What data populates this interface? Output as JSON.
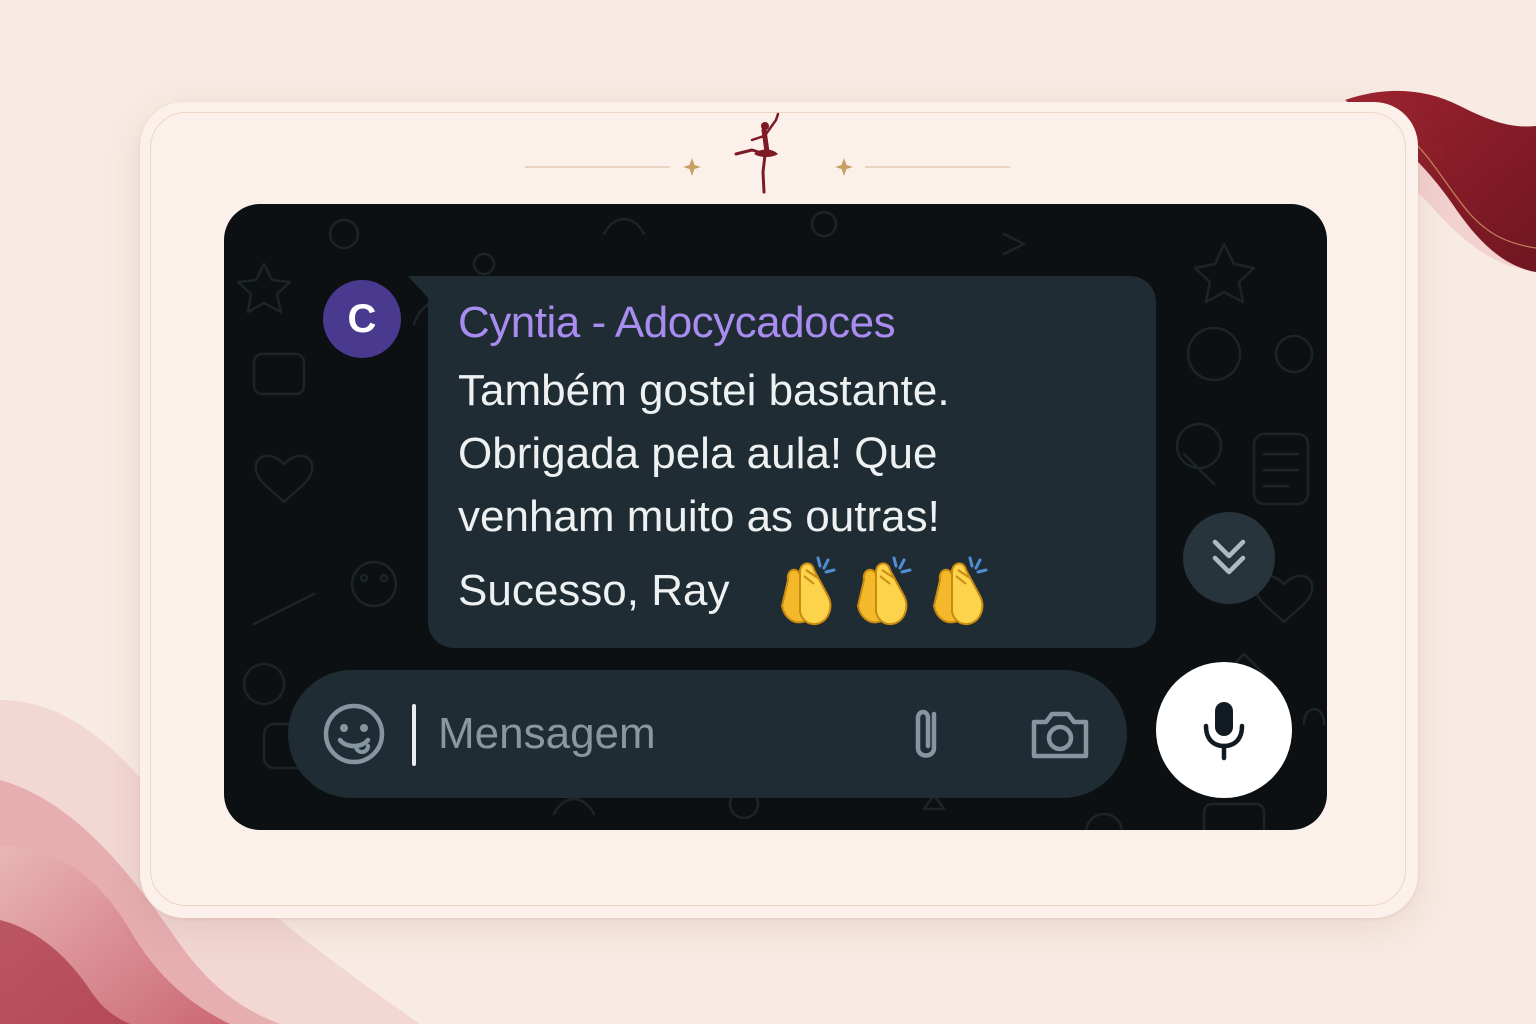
{
  "header": {
    "logo_icon": "ballerina-icon"
  },
  "message": {
    "avatar_letter": "C",
    "sender": "Cyntia - Adocycadoces",
    "lines": [
      "Também gostei bastante.",
      "Obrigada pela aula! Que",
      "venham muito as outras!",
      "Sucesso, Ray"
    ],
    "emoji": [
      "clapping-hands",
      "clapping-hands",
      "clapping-hands"
    ]
  },
  "composer": {
    "placeholder": "Mensagem",
    "value": "",
    "icons": [
      "emoji-icon",
      "paperclip-icon",
      "camera-icon",
      "microphone-icon"
    ]
  },
  "scroll_button": {
    "icon": "double-chevron-down-icon"
  },
  "colors": {
    "page_bg": "#f8ebe3",
    "card_bg": "#fbf1ea",
    "chat_bg": "#0c1013",
    "bubble_bg": "#202c33",
    "sender_name": "#a98cf0",
    "avatar_bg": "#4a3a8f",
    "accent_maroon": "#7d1a26",
    "gold": "#c9a064"
  }
}
